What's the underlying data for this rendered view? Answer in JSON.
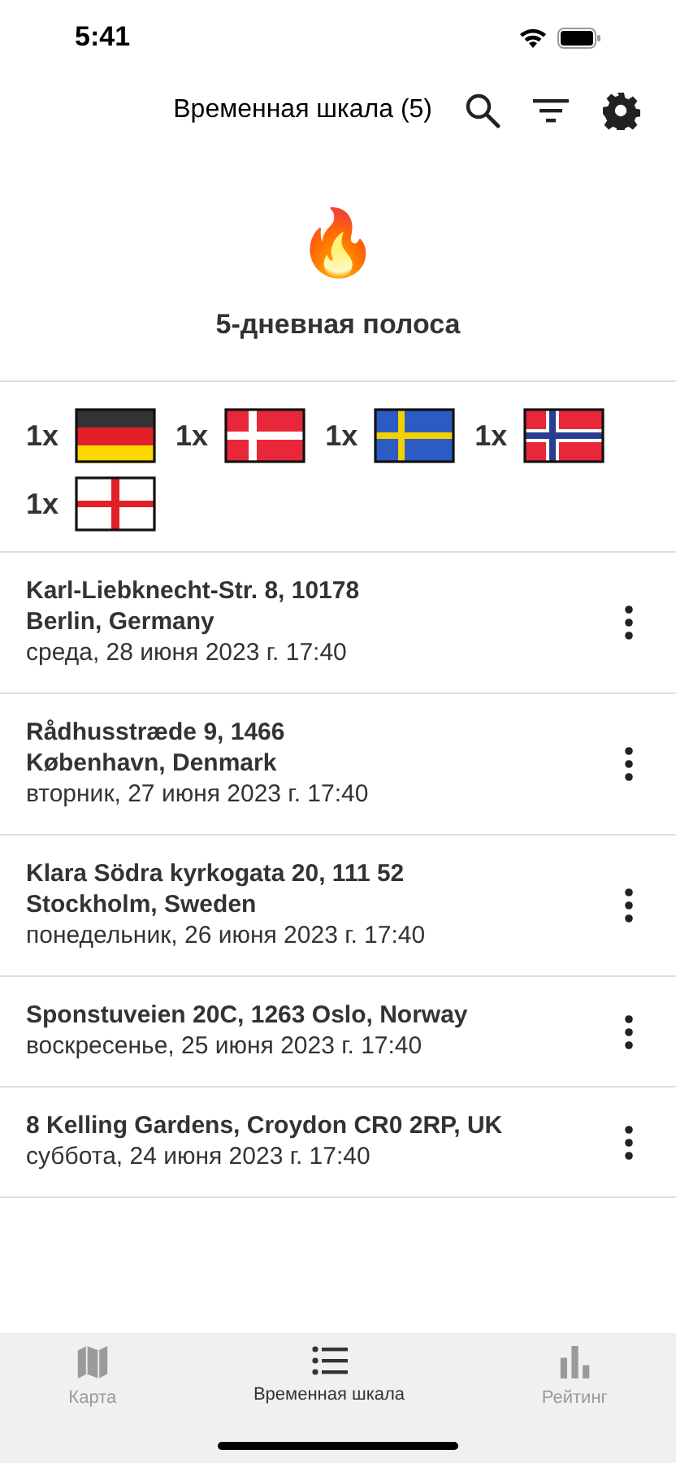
{
  "status_bar": {
    "time": "5:41"
  },
  "header": {
    "title": "Временная шкала (5)"
  },
  "streak": {
    "emoji": "🔥",
    "title": "5-дневная полоса"
  },
  "flags": [
    {
      "count": "1x",
      "kind": "de"
    },
    {
      "count": "1x",
      "kind": "dk"
    },
    {
      "count": "1x",
      "kind": "se"
    },
    {
      "count": "1x",
      "kind": "no"
    },
    {
      "count": "1x",
      "kind": "eng"
    }
  ],
  "entries": [
    {
      "address": [
        "Karl-Liebknecht-Str. 8, 10178",
        "Berlin, Germany"
      ],
      "date": "среда, 28 июня 2023 г. 17:40"
    },
    {
      "address": [
        "Rådhusstræde 9, 1466",
        "København, Denmark"
      ],
      "date": "вторник, 27 июня 2023 г. 17:40"
    },
    {
      "address": [
        "Klara Södra kyrkogata 20, 111 52",
        "Stockholm, Sweden"
      ],
      "date": "понедельник, 26 июня 2023 г. 17:40"
    },
    {
      "address": [
        "Sponstuveien 20C, 1263 Oslo, Norway"
      ],
      "date": "воскресенье, 25 июня 2023 г. 17:40"
    },
    {
      "address": [
        "8 Kelling Gardens, Croydon CR0 2RP, UK"
      ],
      "date": "суббота, 24 июня 2023 г. 17:40"
    }
  ],
  "tabs": [
    {
      "label": "Карта",
      "selected": false
    },
    {
      "label": "Временная шкала",
      "selected": true
    },
    {
      "label": "Рейтинг",
      "selected": false
    }
  ]
}
